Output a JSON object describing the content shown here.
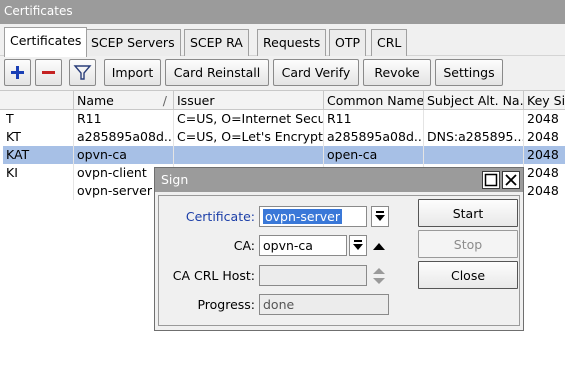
{
  "window": {
    "title": "Certificates"
  },
  "tabs": [
    {
      "label": "Certificates",
      "active": true
    },
    {
      "label": "SCEP Servers"
    },
    {
      "label": "SCEP RA"
    },
    {
      "label": "Requests"
    },
    {
      "label": "OTP"
    },
    {
      "label": "CRL"
    }
  ],
  "toolbar": {
    "add_icon": "plus-icon",
    "remove_icon": "minus-icon",
    "filter_icon": "filter-icon",
    "buttons": [
      "Import",
      "Card Reinstall",
      "Card Verify",
      "Revoke",
      "Settings"
    ]
  },
  "table": {
    "columns": [
      "Name",
      "Issuer",
      "Common Name",
      "Subject Alt. Na...",
      "Key Si"
    ],
    "sort_indicator": "/",
    "rows": [
      {
        "flag": "T",
        "name": "R11",
        "issuer": "C=US, O=Internet Secu...",
        "common_name": "R11",
        "san": "",
        "key_size": "2048"
      },
      {
        "flag": "KT",
        "name": "a285895a08d...",
        "issuer": "C=US, O=Let's Encrypt...",
        "common_name": "a285895a08d...",
        "san": "DNS:a285895...",
        "key_size": "2048"
      },
      {
        "flag": "KAT",
        "name": "opvn-ca",
        "issuer": "",
        "common_name": "open-ca",
        "san": "",
        "key_size": "2048",
        "selected": true
      },
      {
        "flag": "KI",
        "name": "ovpn-client",
        "issuer": "",
        "common_name": "",
        "san": "",
        "key_size": "2048"
      },
      {
        "flag": "",
        "name": "ovpn-server",
        "issuer": "",
        "common_name": "",
        "san": "",
        "key_size": "2048"
      }
    ]
  },
  "dialog": {
    "title": "Sign",
    "fields": {
      "certificate": {
        "label": "Certificate:",
        "value": "ovpn-server"
      },
      "ca": {
        "label": "CA:",
        "value": "opvn-ca"
      },
      "ca_crl_host": {
        "label": "CA CRL Host:",
        "value": ""
      },
      "progress": {
        "label": "Progress:",
        "value": "done"
      }
    },
    "buttons": {
      "start": "Start",
      "stop": "Stop",
      "close": "Close"
    }
  },
  "colors": {
    "title_bar": "#9b9b9b",
    "selected_row": "#a7c0e6",
    "add_icon": "#1a3fb5",
    "remove_icon": "#c42121",
    "certificate_label": "#1c3fa8"
  }
}
